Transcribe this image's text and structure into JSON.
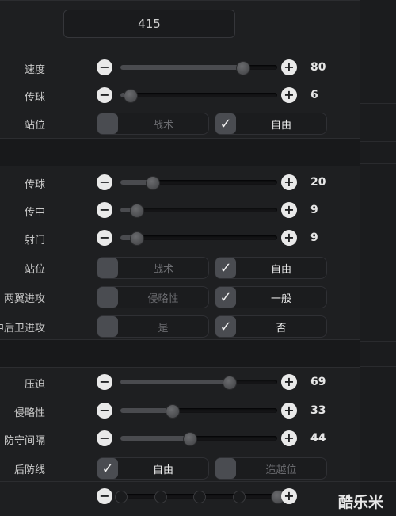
{
  "top_value": "415",
  "group1": {
    "sliders": [
      {
        "label": "速度",
        "value": "80",
        "fraction": 0.78
      },
      {
        "label": "传球",
        "value": "6",
        "fraction": 0.06
      }
    ],
    "toggle": {
      "label": "站位",
      "option_a": "战术",
      "option_a_checked": false,
      "option_b": "自由",
      "option_b_checked": true
    }
  },
  "group2": {
    "sliders": [
      {
        "label": "传球",
        "value": "20",
        "fraction": 0.2
      },
      {
        "label": "传中",
        "value": "9",
        "fraction": 0.1
      },
      {
        "label": "射门",
        "value": "9",
        "fraction": 0.1
      }
    ],
    "toggles": [
      {
        "label": "站位",
        "option_a": "战术",
        "option_a_checked": false,
        "option_b": "自由",
        "option_b_checked": true
      },
      {
        "label": "两翼进攻",
        "option_a": "侵略性",
        "option_a_checked": false,
        "option_b": "一般",
        "option_b_checked": true
      },
      {
        "label": "中后卫进攻",
        "option_a": "是",
        "option_a_checked": false,
        "option_b": "否",
        "option_b_checked": true
      }
    ]
  },
  "group3": {
    "sliders": [
      {
        "label": "压迫",
        "value": "69",
        "fraction": 0.69
      },
      {
        "label": "侵略性",
        "value": "33",
        "fraction": 0.33
      },
      {
        "label": "防守间隔",
        "value": "44",
        "fraction": 0.44
      }
    ],
    "toggle": {
      "label": "后防线",
      "option_a": "自由",
      "option_a_checked": true,
      "option_b": "造越位",
      "option_b_checked": false
    },
    "stepped_slider": {
      "fraction": 1.0,
      "steps": 5
    }
  },
  "icons": {
    "minus": "−",
    "plus": "+",
    "check": "✓"
  },
  "watermark": "酷乐米"
}
